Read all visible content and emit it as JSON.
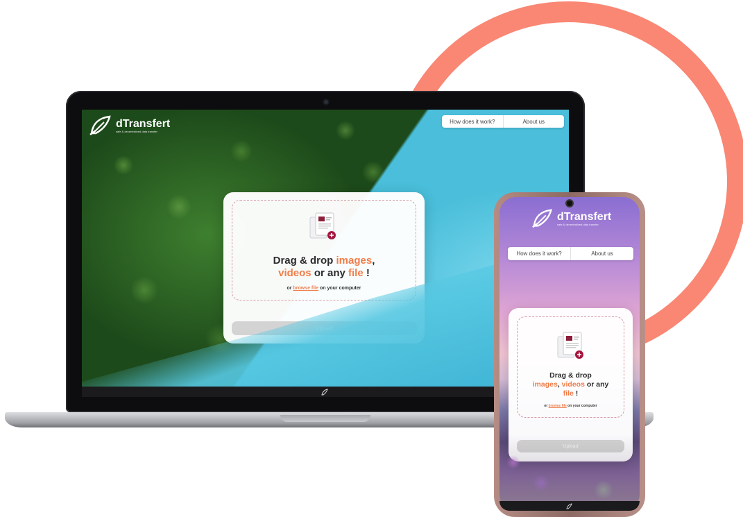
{
  "brand": {
    "name": "dTransfert",
    "tagline": "safe & decentralized data transfer"
  },
  "nav": {
    "how_label": "How does it work?",
    "about_label": "About us"
  },
  "upload": {
    "headline_part1": "Drag & drop ",
    "headline_images": "images",
    "headline_sep": ", ",
    "headline_videos": "videos",
    "headline_part3": " or any ",
    "headline_file": "file",
    "headline_end": " !",
    "browse_prefix": "or ",
    "browse_link": "browse file",
    "browse_suffix": " on your computer",
    "upload_button": "Upload"
  },
  "colors": {
    "accent": "#f07d4a",
    "ring": "#f98774",
    "plus_badge": "#a4153d"
  }
}
